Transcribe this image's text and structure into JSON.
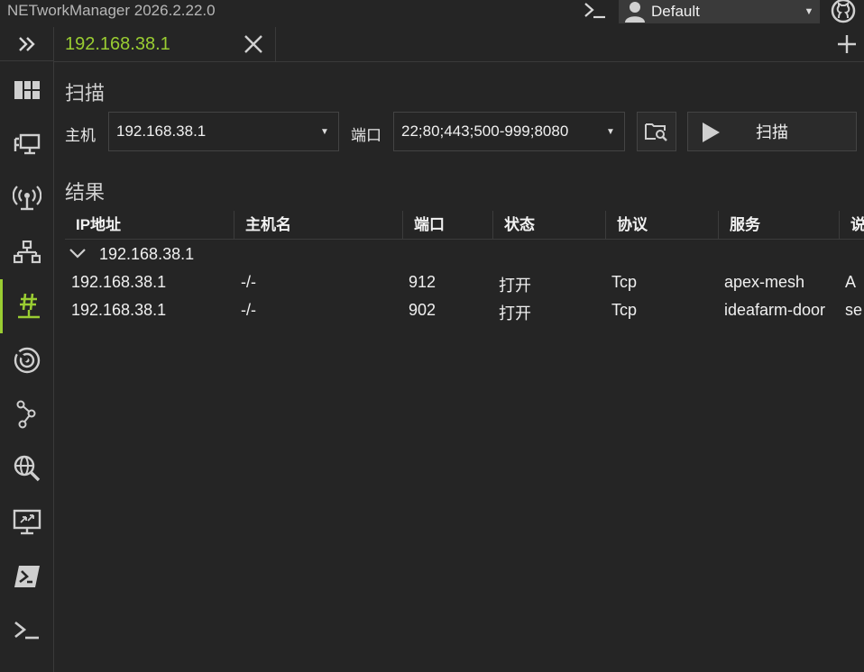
{
  "app": {
    "title": "NETworkManager 2026.2.22.0"
  },
  "profile": {
    "selected": "Default",
    "icon": "user-icon"
  },
  "tabs": [
    {
      "label": "192.168.38.1"
    }
  ],
  "sidebar": {
    "items": [
      {
        "icon": "dashboard-icon"
      },
      {
        "icon": "network-interface-icon"
      },
      {
        "icon": "wifi-icon"
      },
      {
        "icon": "ip-scanner-icon"
      },
      {
        "icon": "port-scanner-icon",
        "active": true
      },
      {
        "icon": "ping-monitor-icon"
      },
      {
        "icon": "traceroute-icon"
      },
      {
        "icon": "dns-lookup-icon"
      },
      {
        "icon": "remote-desktop-icon"
      },
      {
        "icon": "powershell-icon"
      },
      {
        "icon": "terminal-icon"
      }
    ],
    "accent": "#9acd32"
  },
  "scan": {
    "section_title": "扫描",
    "host_label": "主机",
    "host_value": "192.168.38.1",
    "port_label": "端口",
    "port_value": "22;80;443;500-999;8080",
    "button_label": "扫描"
  },
  "results": {
    "section_title": "结果",
    "columns": [
      "IP地址",
      "主机名",
      "端口",
      "状态",
      "协议",
      "服务",
      "说"
    ],
    "group_label": "192.168.38.1",
    "rows": [
      [
        "192.168.38.1",
        "-/-",
        "912",
        "打开",
        "Tcp",
        "apex-mesh",
        "A"
      ],
      [
        "192.168.38.1",
        "-/-",
        "902",
        "打开",
        "Tcp",
        "ideafarm-door",
        "se"
      ]
    ]
  }
}
